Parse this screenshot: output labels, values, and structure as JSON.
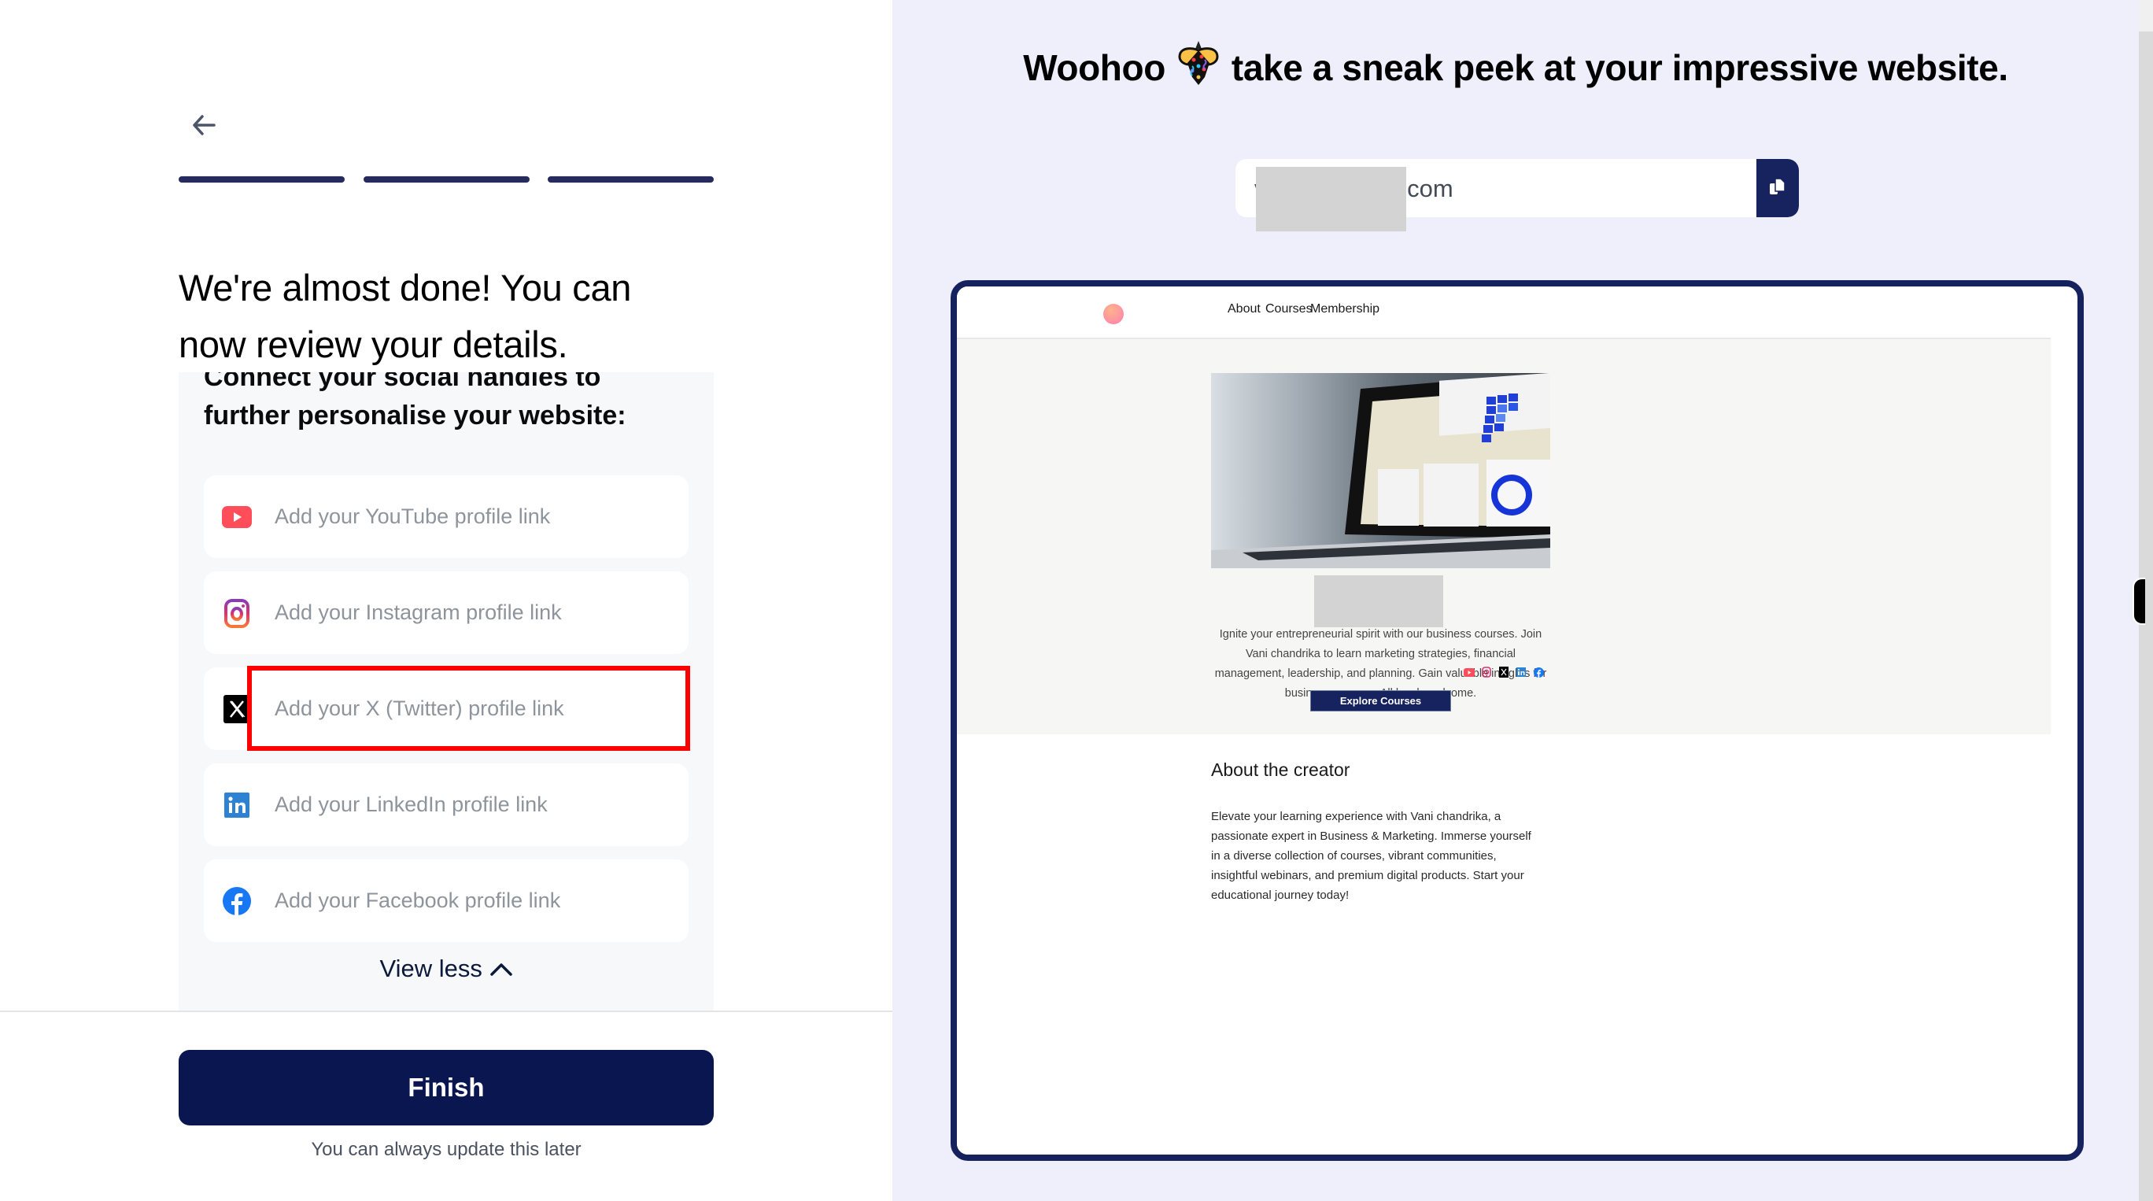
{
  "left_panel": {
    "back_label": "Back",
    "progress_steps_total": 3,
    "progress_steps_complete": 3,
    "heading_line1": "We're almost done! You can",
    "heading_line2": "now review your details.",
    "social_section": {
      "subheading_line1": "Connect your social handles to",
      "subheading_line2": "further personalise your website:",
      "fields": [
        {
          "platform": "youtube",
          "icon": "youtube-icon",
          "placeholder": "Add your YouTube profile link",
          "value": ""
        },
        {
          "platform": "instagram",
          "icon": "instagram-icon",
          "placeholder": "Add your Instagram profile link",
          "value": ""
        },
        {
          "platform": "x",
          "icon": "x-twitter-icon",
          "placeholder": "Add your X (Twitter) profile link",
          "value": ""
        },
        {
          "platform": "linkedin",
          "icon": "linkedin-icon",
          "placeholder": "Add your LinkedIn profile link",
          "value": ""
        },
        {
          "platform": "facebook",
          "icon": "facebook-icon",
          "placeholder": "Add your Facebook profile link",
          "value": ""
        }
      ],
      "view_less_label": "View less"
    },
    "finish_label": "Finish",
    "finish_note": "You can always update this later"
  },
  "right_panel": {
    "title_before": "Woohoo",
    "title_emoji": "party-popper-icon",
    "title_after": "take a sneak peek at your impressive website.",
    "url_value": "v        .graphy.com",
    "copy_label": "Copy link",
    "preview": {
      "nav": [
        "About",
        "Courses",
        "Membership"
      ],
      "hero_alt": "Laptop showing analytics dashboard",
      "description": "Ignite your entrepreneurial spirit with our business courses. Join Vani chandrika to learn marketing strategies, financial management, leadership, and planning. Gain valuable insights for business success. All levels welcome.",
      "social_icons": [
        "youtube-icon",
        "instagram-icon",
        "x-twitter-icon",
        "linkedin-icon",
        "facebook-icon"
      ],
      "cta_label": "Explore Courses",
      "about_title": "About the creator",
      "about_body": "Elevate your learning experience with Vani chandrika, a passionate expert in Business & Marketing. Immerse yourself in a diverse collection of courses, vibrant communities, insightful webinars, and premium digital products. Start your educational journey today!"
    }
  },
  "colors": {
    "primary_navy": "#0A1650",
    "frame_navy": "#15225E",
    "progress": "#262A5C",
    "right_bg": "#EFEFFC",
    "highlight_red": "#FF0000"
  }
}
